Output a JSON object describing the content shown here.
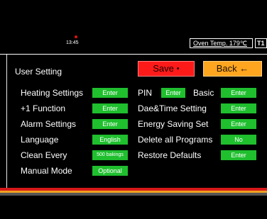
{
  "status": {
    "time": "13:45",
    "oven_temp": "Oven Temp. 179℃",
    "tray": "T1"
  },
  "header": {
    "title": "User Setting",
    "save_label": "Save",
    "save_glyph": "●",
    "back_label": "Back",
    "back_glyph": "←"
  },
  "left_settings": [
    {
      "label": "Heating Settings",
      "button": "Enter"
    },
    {
      "label": "+1 Function",
      "button": "Enter"
    },
    {
      "label": "Alarm Settings",
      "button": "Enter"
    },
    {
      "label": "Language",
      "button": "English"
    },
    {
      "label": "Clean Every",
      "button": "500 bakings"
    },
    {
      "label": "Manual Mode",
      "button": "Optional"
    }
  ],
  "right_settings": {
    "pin_label": "PIN",
    "pin_button": "Enter",
    "basic_label": "Basic",
    "basic_button": "Enter",
    "date_time_label": "Dae&Time Setting",
    "date_time_button": "Enter",
    "energy_label": "Energy Saving Set",
    "energy_button": "Enter",
    "delete_label": "Delete all Programs",
    "delete_button": "No",
    "restore_label": "Restore Defaults",
    "restore_button": "Enter"
  },
  "colors": {
    "button_green": "#1fbf2e",
    "save_red": "#ff1a1a",
    "back_orange": "#ffa51f",
    "background": "#000000"
  },
  "icons": {
    "alarm": "alarm-dot-icon",
    "save": "record-dot-icon",
    "back": "arrow-left-icon"
  }
}
